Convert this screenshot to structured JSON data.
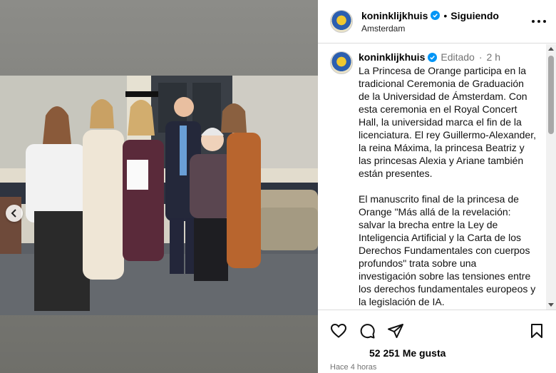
{
  "post": {
    "username": "koninklijkhuis",
    "follow_status": "Siguiendo",
    "location": "Amsterdam",
    "dot": "•"
  },
  "caption": {
    "username": "koninklijkhuis",
    "edited_label": "Editado",
    "dot": "·",
    "time": "2 h",
    "text": "La Princesa de Orange participa en la tradicional Ceremonia de Graduación de la Universidad de Ámsterdam. Con esta ceremonia en el Royal Concert Hall, la universidad marca el fin de la licenciatura. El rey Guillermo-Alexander, la reina Máxima, la princesa Beatriz y las princesas Alexia y Ariane también están presentes.\n\nEl manuscrito final de la princesa de Orange \"Más allá de la revelación: salvar la brecha entre la Ley de Inteligencia Artificial y la Carta de los Derechos Fundamentales con cuerpos profundos\" trata sobre una investigación sobre las tensiones entre los derechos fundamentales europeos y la legislación de IA."
  },
  "engagement": {
    "likes": "52 251 Me gusta",
    "posted_ago": "Hace 4 horas"
  },
  "icons": {
    "like": "heart-icon",
    "comment": "comment-icon",
    "share": "send-icon",
    "save": "bookmark-icon",
    "more": "more-options-icon",
    "verified": "verified-badge-icon",
    "prev": "chevron-left-icon"
  },
  "colors": {
    "verified_blue": "#0095f6",
    "secondary_text": "#737373",
    "divider": "#dbdbdb"
  }
}
